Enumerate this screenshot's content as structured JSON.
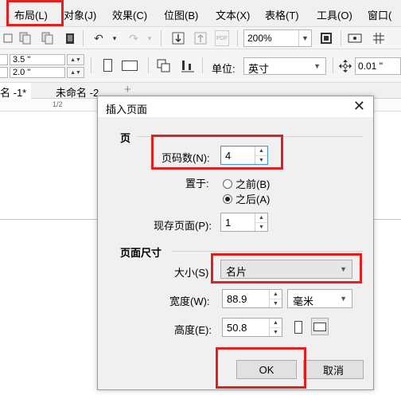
{
  "menu": {
    "layout": "布局(L)",
    "object": "对象(J)",
    "effects": "效果(C)",
    "bitmaps": "位图(B)",
    "text": "文本(X)",
    "table": "表格(T)",
    "tools": "工具(O)",
    "window": "窗口("
  },
  "toolbar": {
    "zoom_value": "200%",
    "pdf_label": "PDF"
  },
  "propbar": {
    "width_value": "3.5 \"",
    "height_value": "2.0 \"",
    "unit_label": "单位:",
    "unit_value": "英寸",
    "nudge_value": "0.01 \""
  },
  "tabs": [
    {
      "label": "名 -1*"
    },
    {
      "label": "未命名 -2"
    }
  ],
  "add_tab_label": "+",
  "ruler": {
    "mark": "1/2"
  },
  "dialog": {
    "title": "插入页面",
    "close_glyph": "✕",
    "section_page": "页",
    "page_count_label": "页码数(N):",
    "page_count_value": "4",
    "place_label": "置于:",
    "before_label": "之前(B)",
    "after_label": "之后(A)",
    "selected_position": "after",
    "existing_page_label": "现存页面(P):",
    "existing_page_value": "1",
    "section_size": "页面尺寸",
    "size_label": "大小(S)",
    "size_value": "名片",
    "width_label": "宽度(W):",
    "width_value": "88.9",
    "unit_value": "毫米",
    "height_label": "高度(E):",
    "height_value": "50.8",
    "ok_label": "OK",
    "cancel_label": "取消"
  },
  "colors": {
    "highlight": "#e02020",
    "menubar_bg": "#f0f0f0",
    "dialog_bg": "#f0f0f0",
    "focus_border": "#3c8fd8"
  },
  "icons": [
    "undo-icon",
    "redo-icon",
    "import-icon",
    "export-icon",
    "fullscreen-icon",
    "portrait-icon",
    "landscape-icon",
    "nudge-icon"
  ]
}
